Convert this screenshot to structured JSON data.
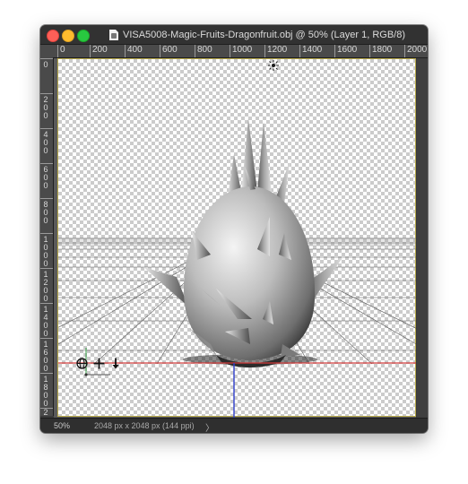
{
  "window": {
    "title": "VISA5008-Magic-Fruits-Dragonfruit.obj @ 50% (Layer 1, RGB/8)"
  },
  "ruler_top": {
    "labels": [
      "0",
      "200",
      "400",
      "600",
      "800",
      "1000",
      "1200",
      "1400",
      "1600",
      "1800",
      "2000"
    ]
  },
  "ruler_left": {
    "labels": [
      "0",
      "200",
      "400",
      "600",
      "800",
      "1000",
      "1200",
      "1400",
      "1600",
      "1800",
      "2"
    ]
  },
  "canvas": {
    "content": "3d-dragonfruit-model",
    "widgets": [
      "orbit-3d-icon",
      "pan-3d-icon",
      "slide-3d-icon"
    ],
    "light_icon": "light-source-icon",
    "axes": {
      "x_color": "#d23a3a",
      "y_color": "#2f9a3f",
      "z_color": "#2f3fcc"
    }
  },
  "status": {
    "zoom": "50%",
    "document_info": "2048 px x 2048 px (144 ppi)",
    "arrow": "〉"
  },
  "colors": {
    "window_bg": "#3a3a3a",
    "ruler_bg": "#4a4a4a",
    "canvas_border": "#b7a94a"
  }
}
